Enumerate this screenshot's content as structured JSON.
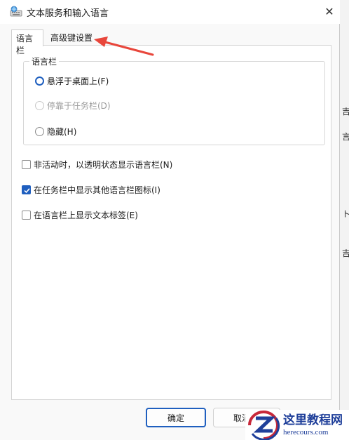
{
  "window": {
    "title": "文本服务和输入语言",
    "close_glyph": "✕",
    "app_icon": "keyboard-globe-icon"
  },
  "tabs": [
    {
      "label": "语言栏",
      "active": true
    },
    {
      "label": "高级键设置",
      "active": false
    }
  ],
  "language_bar_group": {
    "title": "语言栏",
    "options": [
      {
        "label": "悬浮于桌面上(F)",
        "checked": true,
        "disabled": false
      },
      {
        "label": "停靠于任务栏(D)",
        "checked": false,
        "disabled": true
      },
      {
        "label": "隐藏(H)",
        "checked": false,
        "disabled": false
      }
    ]
  },
  "checkboxes": [
    {
      "label": "非活动时，以透明状态显示语言栏(N)",
      "checked": false
    },
    {
      "label": "在任务栏中显示其他语言栏图标(I)",
      "checked": true
    },
    {
      "label": "在语言栏上显示文本标签(E)",
      "checked": false
    }
  ],
  "buttons": {
    "ok": "确定",
    "cancel": "取消"
  },
  "annotation": {
    "arrow_color": "#e8463b"
  },
  "watermark": {
    "line1": "这里教程网",
    "line2": "herecours.com"
  },
  "background_fragments": [
    "吉",
    "言",
    "ト",
    "吉"
  ],
  "colors": {
    "accent": "#1f5fbf"
  }
}
